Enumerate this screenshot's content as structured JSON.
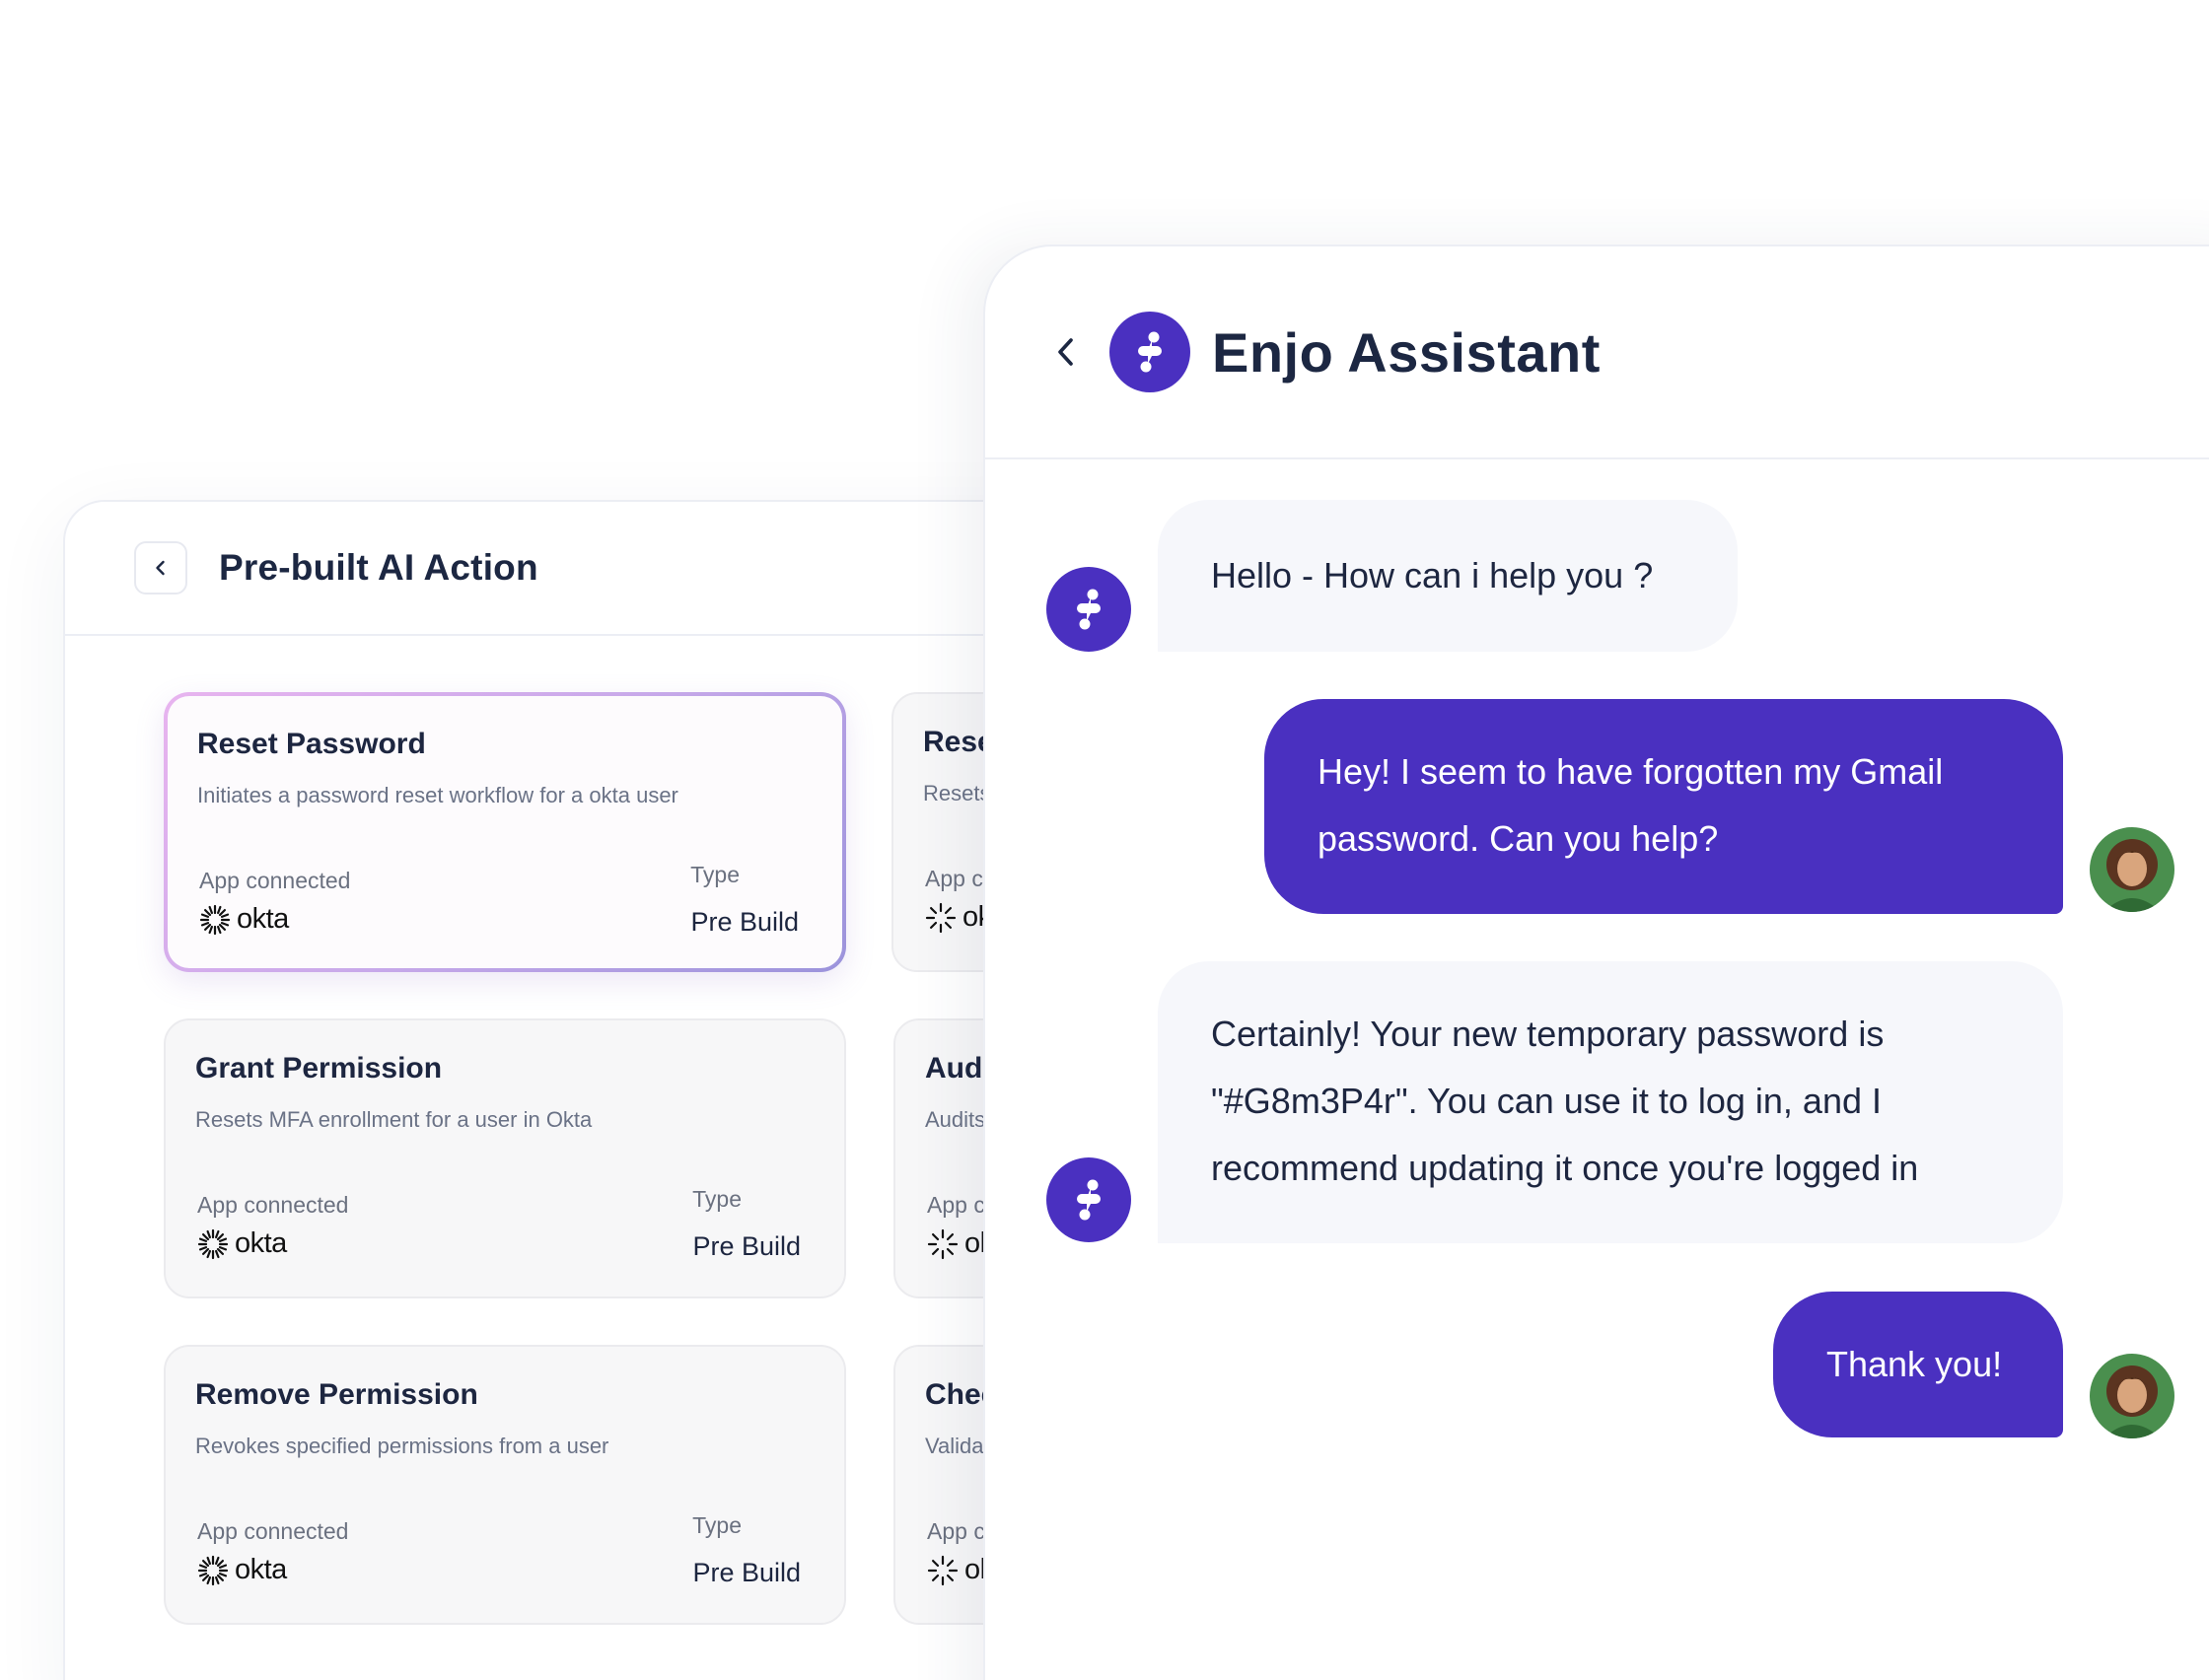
{
  "actions_panel": {
    "title": "Pre-built AI Action",
    "cards": [
      {
        "title": "Reset Password",
        "desc": "Initiates a password reset workflow for a okta user",
        "app_label": "App connected",
        "app_name": "okta",
        "type_label": "Type",
        "type_value": "Pre Build"
      },
      {
        "title": "Grant Permission",
        "desc": "Resets MFA enrollment for a user in Okta",
        "app_label": "App connected",
        "app_name": "okta",
        "type_label": "Type",
        "type_value": "Pre Build"
      },
      {
        "title": "Remove Permission",
        "desc": "Revokes specified permissions from a user",
        "app_label": "App connected",
        "app_name": "okta",
        "type_label": "Type",
        "type_value": "Pre Build"
      }
    ],
    "partial_cards": [
      {
        "title": "Rese",
        "desc": "Resets",
        "app_label": "App c",
        "app_name": "ok"
      },
      {
        "title": "Audi",
        "desc": "Audits",
        "app_label": "App c",
        "app_name": "ol"
      },
      {
        "title": "Chec",
        "desc": "Valida",
        "app_label": "App c",
        "app_name": "ol"
      }
    ]
  },
  "chat": {
    "title": "Enjo Assistant",
    "messages": [
      {
        "from": "bot",
        "text": "Hello - How can i help you ?"
      },
      {
        "from": "user",
        "line1": "Hey! I seem to have forgotten my Gmail",
        "line2": "password. Can you help?"
      },
      {
        "from": "bot",
        "line1": "Certainly! Your new temporary password is",
        "line2": "\"#G8m3P4r\". You can use it to log in, and I",
        "line3": "recommend updating it once you're logged in"
      },
      {
        "from": "user",
        "text": "Thank you!"
      }
    ]
  },
  "colors": {
    "accent": "#4a30c0",
    "bot_bubble": "#f6f7fb",
    "text_dark": "#1c2742",
    "muted": "#6b7180"
  },
  "icons": {
    "back": "chevron-left-icon",
    "brand": "enjo-logo-icon",
    "app": "okta-sunburst-icon",
    "user": "user-photo-avatar"
  }
}
